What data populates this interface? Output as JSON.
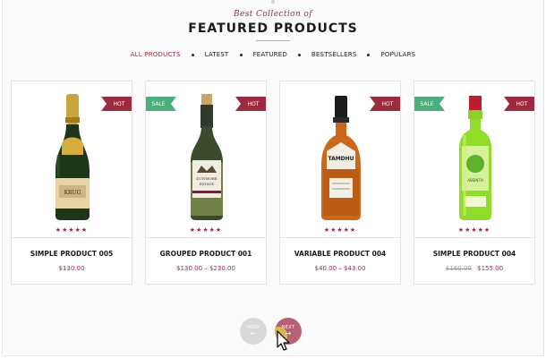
{
  "header": {
    "script_title": "Best Collection of",
    "title": "FEATURED PRODUCTS"
  },
  "filters": [
    {
      "label": "ALL PRODUCTS",
      "active": true
    },
    {
      "label": "LATEST",
      "active": false
    },
    {
      "label": "FEATURED",
      "active": false
    },
    {
      "label": "BESTSELLERS",
      "active": false
    },
    {
      "label": "POPULARS",
      "active": false
    }
  ],
  "products": [
    {
      "name": "SIMPLE PRODUCT 005",
      "rating": "★★★★★",
      "badges": [
        "HOT"
      ],
      "price": "$130.00",
      "old_price": "",
      "bottle_icon": "champagne-bottle-icon"
    },
    {
      "name": "GROUPED PRODUCT 001",
      "rating": "★★★★★",
      "badges": [
        "SALE",
        "HOT"
      ],
      "price": "$130.00 – $230.00",
      "old_price": "",
      "bottle_icon": "white-wine-bottle-icon"
    },
    {
      "name": "VARIABLE PRODUCT 004",
      "rating": "★★★★★",
      "badges": [
        "HOT"
      ],
      "price": "$40.00 – $43.00",
      "old_price": "",
      "bottle_icon": "whisky-bottle-icon"
    },
    {
      "name": "SIMPLE PRODUCT 004",
      "rating": "★★★★★",
      "badges": [
        "SALE",
        "HOT"
      ],
      "price": "$155.00",
      "old_price": "$160.00",
      "bottle_icon": "green-liqueur-bottle-icon"
    }
  ],
  "badges": {
    "hot": "HOT",
    "sale": "SALE"
  },
  "pagination": {
    "prev_label": "PREV",
    "next_label": "NEXT",
    "prev_arrow": "←",
    "next_arrow": "→"
  },
  "colors": {
    "accent": "#9b2b3f",
    "sale": "#4cae7d",
    "prev_button": "#d9d9d9",
    "next_button": "#b96174"
  }
}
